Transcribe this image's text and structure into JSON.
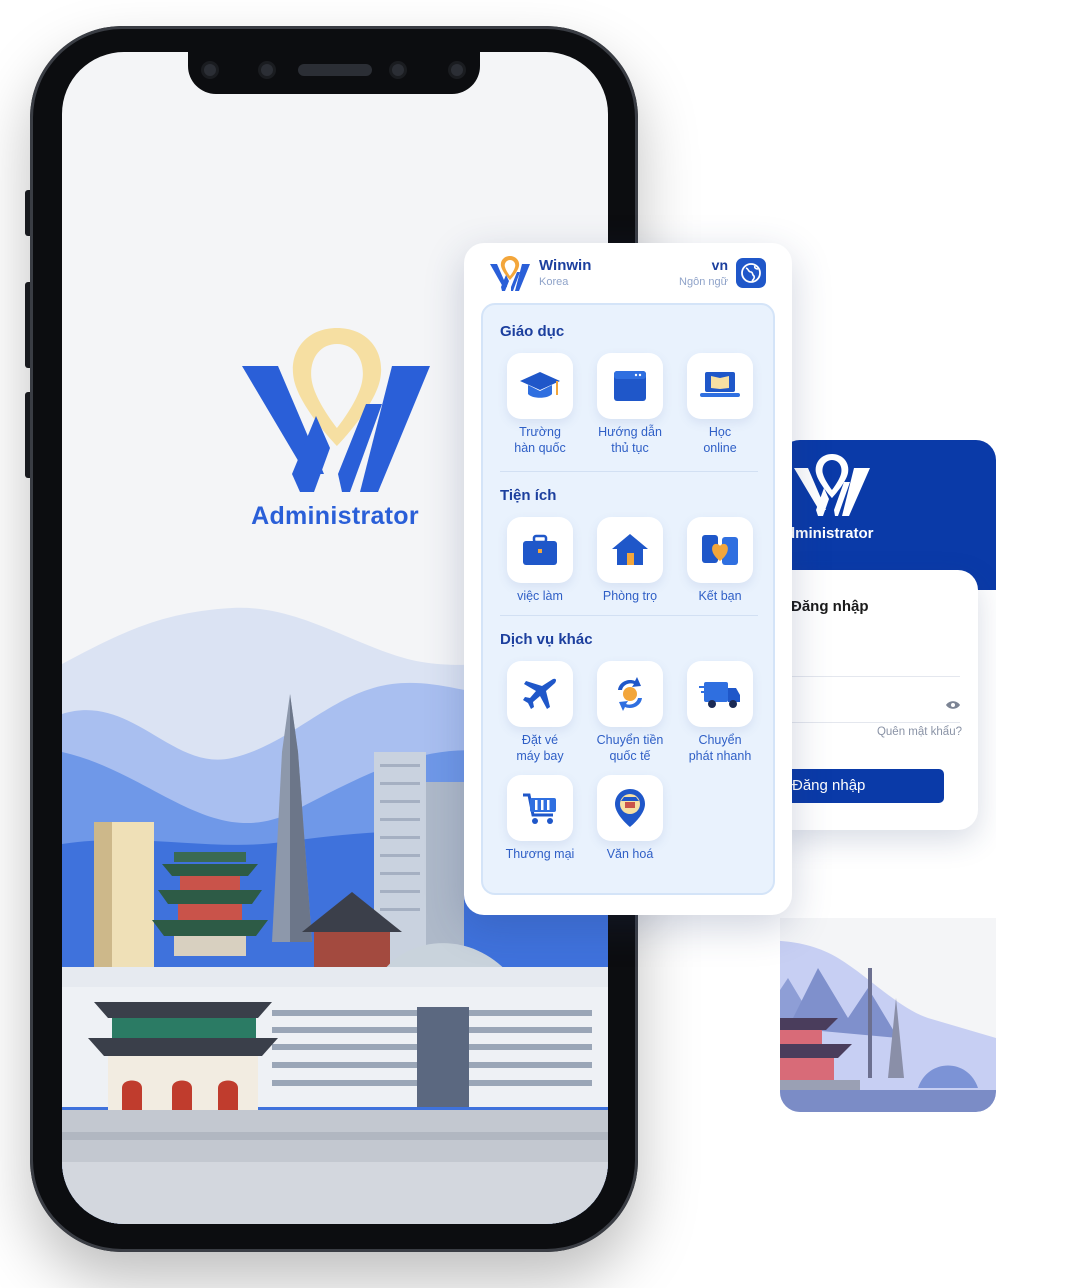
{
  "splash": {
    "title": "Administrator"
  },
  "services_card": {
    "brand": "Winwin",
    "brand_sub": "Korea",
    "language_code": "vn",
    "language_label": "Ngôn ngữ",
    "sections": [
      {
        "title": "Giáo dục",
        "items": [
          {
            "label": "Trường\nhàn quốc",
            "icon": "graduation-cap-icon"
          },
          {
            "label": "Hướng dẫn\nthủ tục",
            "icon": "folder-icon"
          },
          {
            "label": "Học\nonline",
            "icon": "laptop-book-icon"
          }
        ]
      },
      {
        "title": "Tiện ích",
        "items": [
          {
            "label": "việc làm",
            "icon": "briefcase-icon"
          },
          {
            "label": "Phòng trọ",
            "icon": "house-icon"
          },
          {
            "label": "Kết bạn",
            "icon": "friends-heart-icon"
          }
        ]
      },
      {
        "title": "Dịch vụ khác",
        "items": [
          {
            "label": "Đặt vé\nmáy bay",
            "icon": "airplane-icon"
          },
          {
            "label": "Chuyển tiền\nquốc tế",
            "icon": "money-transfer-icon"
          },
          {
            "label": "Chuyển\nphát nhanh",
            "icon": "delivery-truck-icon"
          },
          {
            "label": "Thương mại",
            "icon": "shopping-cart-icon"
          },
          {
            "label": "Văn hoá",
            "icon": "culture-pin-icon"
          }
        ]
      }
    ]
  },
  "login": {
    "title": "dministrator",
    "heading": "Đăng nhập",
    "forgot": "Quên mật khẩu?",
    "button": "Đăng nhập"
  },
  "colors": {
    "brand_blue": "#1c3f9e",
    "accent_blue": "#2a5fd8",
    "navy": "#0a3aa8",
    "pin_yellow": "#f6dfa2",
    "panel_bg": "#e9f2fd"
  }
}
